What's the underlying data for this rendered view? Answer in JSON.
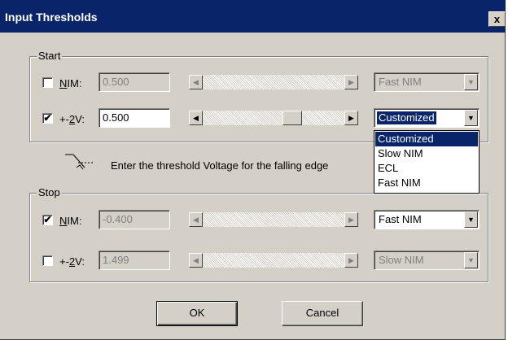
{
  "window": {
    "title": "Input Thresholds",
    "close_label": "x"
  },
  "start": {
    "label": "Start",
    "nim": {
      "checked": false,
      "label_prefix": "",
      "label_ul": "N",
      "label_rest": "IM:",
      "value": "0.500",
      "combo": "Fast NIM"
    },
    "p2v": {
      "checked": true,
      "label_prefix": "+-",
      "label_ul": "2",
      "label_rest": "V:",
      "value": "0.500",
      "combo": "Customized"
    }
  },
  "dropdown": {
    "items": [
      "Customized",
      "Slow NIM",
      "ECL",
      "Fast NIM"
    ],
    "highlighted": 0
  },
  "info": {
    "text": "Enter the threshold Voltage for the falling edge",
    "icon": "falling-edge-icon"
  },
  "stop": {
    "label": "Stop",
    "nim": {
      "checked": true,
      "label_prefix": "",
      "label_ul": "N",
      "label_rest": "IM:",
      "value": "-0.400",
      "combo": "Fast NIM"
    },
    "p2v": {
      "checked": false,
      "label_prefix": "+-",
      "label_ul": "2",
      "label_rest": "V:",
      "value": "1.499",
      "combo": "Slow NIM"
    }
  },
  "buttons": {
    "ok": "OK",
    "cancel": "Cancel"
  },
  "glyphs": {
    "check": "✔",
    "left": "◀",
    "right": "▶",
    "down": "▼"
  },
  "colors": {
    "titlebar": "#0a246a",
    "face": "#d4d0c8",
    "highlight": "#0a246a"
  }
}
